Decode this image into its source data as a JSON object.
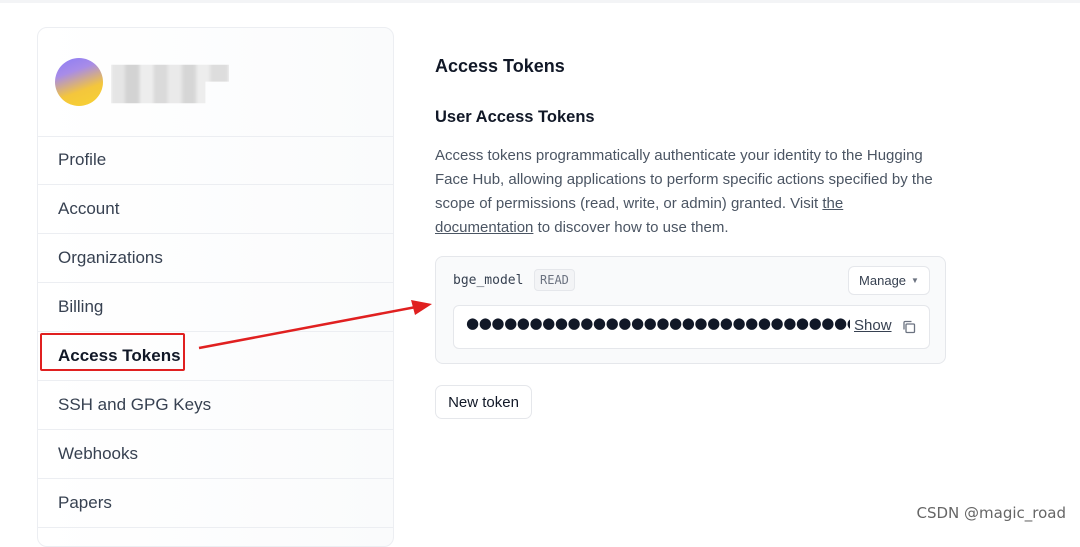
{
  "sidebar": {
    "username": "",
    "items": [
      {
        "label": "Profile",
        "name": "sidebar-item-profile"
      },
      {
        "label": "Account",
        "name": "sidebar-item-account"
      },
      {
        "label": "Organizations",
        "name": "sidebar-item-organizations"
      },
      {
        "label": "Billing",
        "name": "sidebar-item-billing"
      },
      {
        "label": "Access Tokens",
        "name": "sidebar-item-access-tokens",
        "active": true
      },
      {
        "label": "SSH and GPG Keys",
        "name": "sidebar-item-ssh-gpg-keys"
      },
      {
        "label": "Webhooks",
        "name": "sidebar-item-webhooks"
      },
      {
        "label": "Papers",
        "name": "sidebar-item-papers"
      }
    ]
  },
  "main": {
    "page_title": "Access Tokens",
    "section_title": "User Access Tokens",
    "description": {
      "before_link": "Access tokens programmatically authenticate your identity to the Hugging Face Hub, allowing applications to perform specific actions specified by the scope of permissions (read, write, or admin) granted. Visit ",
      "link_text": "the documentation",
      "after_link": " to discover how to use them."
    },
    "token": {
      "name": "bge_model",
      "role": "READ",
      "manage_label": "Manage",
      "masked_value": "●●●●●●●●●●●●●●●●●●●●●●●●●●●●●●●●●●●●●",
      "show_label": "Show"
    },
    "new_token_label": "New token"
  },
  "annotation": {
    "color": "#e02020"
  },
  "watermark": "CSDN @magic_road"
}
